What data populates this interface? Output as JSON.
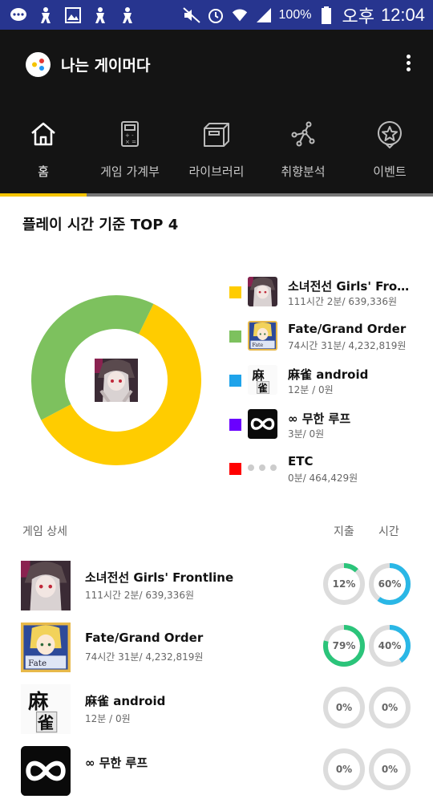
{
  "status": {
    "battery_pct": "100%",
    "ampm": "오후",
    "time": "12:04"
  },
  "app": {
    "title": "나는 게이머다"
  },
  "tabs": [
    {
      "label": "홈",
      "icon": "home-icon"
    },
    {
      "label": "게임 가계부",
      "icon": "calculator-icon"
    },
    {
      "label": "라이브러리",
      "icon": "box-icon"
    },
    {
      "label": "취향분석",
      "icon": "network-icon"
    },
    {
      "label": "이벤트",
      "icon": "star-badge-icon"
    }
  ],
  "top4": {
    "title": "플레이 시간 기준 TOP 4",
    "legend": [
      {
        "name": "소녀전선 Girls' Fron...",
        "sub": "111시간 2분/ 639,336원",
        "color": "#ffcc00"
      },
      {
        "name": "Fate/Grand Order",
        "sub": "74시간 31분/ 4,232,819원",
        "color": "#7dc15e"
      },
      {
        "name": "麻雀 android",
        "sub": "12분 / 0원",
        "color": "#1fa3ea"
      },
      {
        "name": "∞ 무한 루프",
        "sub": "3분/ 0원",
        "color": "#6a00ff"
      },
      {
        "name": "ETC",
        "sub": "0분/ 464,429원",
        "color": "#ff0000"
      }
    ]
  },
  "chart_data": {
    "type": "pie",
    "title": "플레이 시간 기준 TOP 4",
    "categories": [
      "소녀전선 Girls' Frontline",
      "Fate/Grand Order",
      "麻雀 android",
      "∞ 무한 루프",
      "ETC"
    ],
    "values": [
      60,
      40,
      0,
      0,
      0
    ],
    "colors": [
      "#ffcc00",
      "#7dc15e",
      "#1fa3ea",
      "#6a00ff",
      "#ff0000"
    ]
  },
  "detail": {
    "title": "게임 상세",
    "col_spend": "지출",
    "col_time": "시간",
    "rows": [
      {
        "name": "소녀전선 Girls' Frontline",
        "sub": "111시간 2분/ 639,336원",
        "spend_pct": 12,
        "spend_label": "12%",
        "time_pct": 60,
        "time_label": "60%"
      },
      {
        "name": "Fate/Grand Order",
        "sub": "74시간 31분/ 4,232,819원",
        "spend_pct": 79,
        "spend_label": "79%",
        "time_pct": 40,
        "time_label": "40%"
      },
      {
        "name": "麻雀 android",
        "sub": "12분 / 0원",
        "spend_pct": 0,
        "spend_label": "0%",
        "time_pct": 0,
        "time_label": "0%"
      },
      {
        "name": "∞ 무한 루프",
        "sub": "",
        "spend_pct": 0,
        "spend_label": "0%",
        "time_pct": 0,
        "time_label": "0%"
      }
    ],
    "spend_color": "#2bc47a",
    "time_color": "#2ab7e6"
  }
}
